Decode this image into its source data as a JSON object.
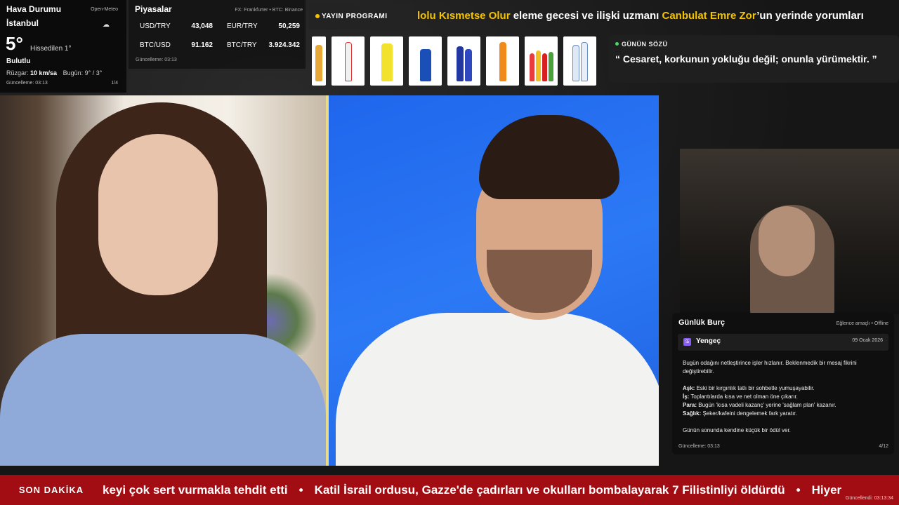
{
  "weather": {
    "title": "Hava Durumu",
    "source": "Open-Meteo",
    "city": "İstanbul",
    "icon": "cloud-icon",
    "temp": "5°",
    "feels": "Hissedilen 1°",
    "condition": "Bulutlu",
    "wind_label": "Rüzgar:",
    "wind": "10 km/sa",
    "today_label": "Bugün:",
    "today": "9° / 3°",
    "updated": "Güncelleme: 03:13",
    "page": "1/4"
  },
  "markets": {
    "title": "Piyasalar",
    "source": "FX: Frankfurter • BTC: Binance",
    "rows": [
      {
        "label": "USD/TRY",
        "value": "43,048"
      },
      {
        "label": "EUR/TRY",
        "value": "50,259"
      },
      {
        "label": "BTC/USD",
        "value": "91.162"
      },
      {
        "label": "BTC/TRY",
        "value": "3.924.342"
      }
    ],
    "updated": "Güncelleme: 03:13"
  },
  "schedule": {
    "label": "YAYIN PROGRAMI"
  },
  "marquee": {
    "part1": "lolu Kısmetse Olur",
    "part2": " eleme gecesi ve ilişki uzmanı ",
    "part3": "Canbulat Emre Zor",
    "part4": "’un yerinde yorumları"
  },
  "quote": {
    "label": "GÜNÜN SÖZÜ",
    "text": "“ Cesaret, korkunun yokluğu değil; onunla yürümektir. ”"
  },
  "horoscope": {
    "title": "Günlük Burç",
    "meta": "Eğlence amaçlı • Offline",
    "sign": "Yengeç",
    "date": "09 Ocak 2026",
    "intro": "Bugün odağını netleştirince işler hızlanır. Beklenmedik bir mesaj fikrini değiştirebilir.",
    "love_label": "Aşk:",
    "love": " Eski bir kırgınlık tatlı bir sohbetle yumuşayabilir.",
    "work_label": "İş:",
    "work": " Toplantılarda kısa ve net olman öne çıkarır.",
    "money_label": "Para:",
    "money": " Bugün 'kısa vadeli kazanç' yerine 'sağlam plan' kazanır.",
    "health_label": "Sağlık:",
    "health": " Şeker/kafeini dengelemek fark yaratır.",
    "closing": "Günün sonunda kendine küçük bir ödül ver.",
    "updated": "Güncelleme: 03:13",
    "page": "4/12"
  },
  "news": {
    "label": "SON DAKİKA",
    "items": [
      "keyi çok sert vurmakla tehdit etti",
      "Katil İsrail ordusu, Gazze'de çadırları ve okulları bombalayarak 7 Filistinliyi öldürdü",
      "Hiyer"
    ],
    "separator": "•",
    "updated": "Güncellendi: 03:13:34"
  },
  "colors": {
    "accent": "#f5c400",
    "news_bg": "#a10d12",
    "quote_dot": "#4cd964",
    "sign_icon": "#8a5cf6"
  }
}
